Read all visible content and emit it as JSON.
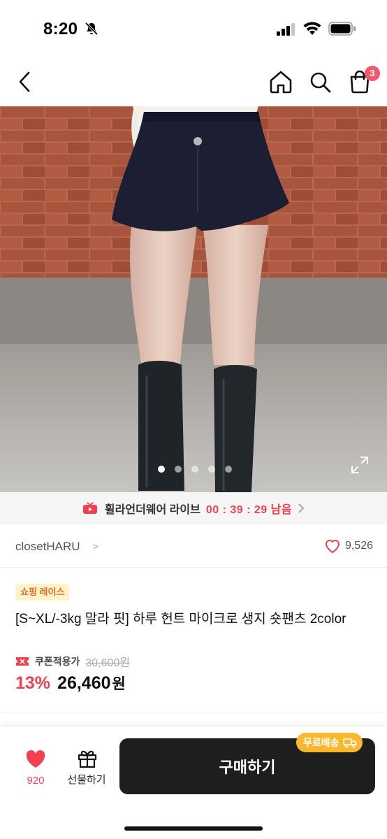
{
  "status_bar": {
    "time": "8:20",
    "icons": [
      "bell-off-icon",
      "signal-icon",
      "wifi-icon",
      "battery-icon"
    ]
  },
  "nav": {
    "icons": [
      "back-arrow-icon",
      "home-icon",
      "search-icon",
      "shopping-bag-icon"
    ],
    "cart_count": "3"
  },
  "gallery": {
    "image_count": 5,
    "active_index": 0,
    "expand_icon": "expand-icon"
  },
  "live_banner": {
    "icon": "live-video-icon",
    "title": "휠라언더웨어 라이브",
    "timer": "00 : 39 : 29",
    "suffix": "남음"
  },
  "store": {
    "name": "closetHARU",
    "chevron": ">",
    "like_count": "9,526"
  },
  "product": {
    "badge": "쇼핑 레이스",
    "title": "[S~XL/-3kg 말라 핏] 하루 헌트 마이크로 생지 숏팬츠 2color",
    "coupon_label": "쿠폰적용가",
    "original_price": "30,600원",
    "discount": "13%",
    "price": "26,460",
    "price_unit": "원"
  },
  "bottom_bar": {
    "like_count": "920",
    "gift_label": "선물하기",
    "buy_label": "구매하기",
    "free_shipping": "무료배송"
  },
  "colors": {
    "accent_red": "#f2404f",
    "badge_pink": "#f2596d",
    "buy_button": "#1e1e1e",
    "free_ship": "#fbb82e",
    "tag_bg": "#fff2c7",
    "tag_text": "#e16b2d"
  }
}
